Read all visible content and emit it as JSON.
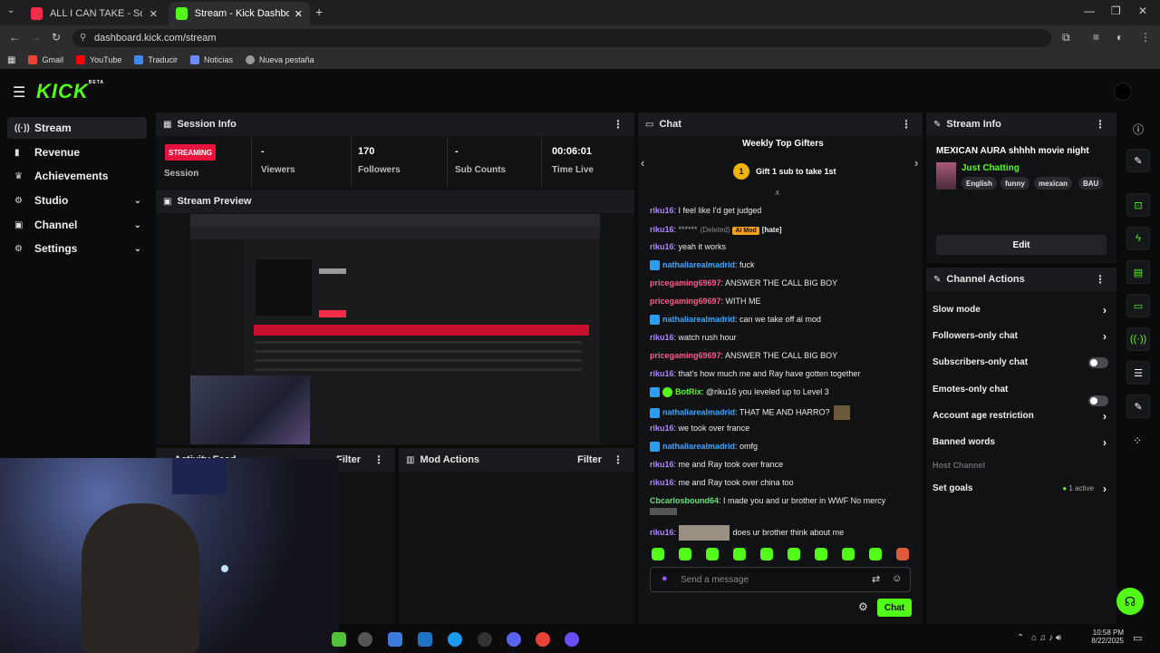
{
  "browser": {
    "tabs": [
      {
        "title": "ALL I CAN TAKE - Song by Justi"
      },
      {
        "title": "Stream - Kick Dashboard"
      }
    ],
    "url": "dashboard.kick.com/stream",
    "bookmarks": [
      "Gmail",
      "YouTube",
      "Traducir",
      "Noticias",
      "Nueva pestaña"
    ]
  },
  "app": {
    "logo": "KICK",
    "logo_badge": "BETA"
  },
  "sidebar": {
    "items": [
      {
        "label": "Stream",
        "icon": "broadcast-icon"
      },
      {
        "label": "Revenue",
        "icon": "revenue-icon"
      },
      {
        "label": "Achievements",
        "icon": "achievements-icon"
      },
      {
        "label": "Studio",
        "icon": "studio-icon"
      },
      {
        "label": "Channel",
        "icon": "channel-icon"
      },
      {
        "label": "Settings",
        "icon": "settings-icon"
      }
    ]
  },
  "session": {
    "title": "Session Info",
    "badge": "STREAMING",
    "session_label": "Session",
    "viewers_val": "-",
    "viewers_label": "Viewers",
    "followers_val": "170",
    "followers_label": "Followers",
    "subs_val": "-",
    "subs_label": "Sub Counts",
    "time_val": "00:06:01",
    "time_label": "Time Live"
  },
  "preview": {
    "title": "Stream Preview"
  },
  "activity": {
    "title": "Activity Feed",
    "filter": "Filter"
  },
  "mod": {
    "title": "Mod Actions",
    "filter": "Filter"
  },
  "chat": {
    "title": "Chat",
    "gifters_title": "Weekly Top Gifters",
    "gifters_rank": "1",
    "gifters_text": "Gift 1 sub to take 1st",
    "deleted": "(Deleted)",
    "ai_mod": "AI Mod",
    "hate": "[hate]",
    "masked": "******",
    "messages": [
      {
        "user": "riku16",
        "text": ": I feel like I'd get judged"
      },
      {
        "user": "riku16",
        "text": ": yeah it works"
      },
      {
        "user": "nathaliarealmadrid",
        "text": ": fuck"
      },
      {
        "user": "pricegaming69697",
        "text": ": ANSWER THE CALL BIG BOY"
      },
      {
        "user": "pricegaming69697",
        "text": ": WITH ME"
      },
      {
        "user": "nathaliarealmadrid",
        "text": ": can we take off ai mod"
      },
      {
        "user": "riku16",
        "text": ": watch rush hour"
      },
      {
        "user": "pricegaming69697",
        "text": ": ANSWER THE CALL BIG BOY"
      },
      {
        "user": "riku16",
        "text": ": that's how much me and Ray have gotten together"
      },
      {
        "user": "BotRix",
        "text": ": @riku16 you leveled up to Level 3"
      },
      {
        "user": "nathaliarealmadrid",
        "text": ": THAT ME AND HARRO?"
      },
      {
        "user": "riku16",
        "text": ": we took over france"
      },
      {
        "user": "nathaliarealmadrid",
        "text": ": omfg"
      },
      {
        "user": "riku16",
        "text": ": me and Ray took over france"
      },
      {
        "user": "riku16",
        "text": ": me and Ray took over china too"
      },
      {
        "user": "Cbcarlosbound64",
        "text": ": I made you and ur brother in WWF No mercy"
      },
      {
        "user": "riku16",
        "text": "does ur brother think about me"
      }
    ],
    "placeholder": "Send a message",
    "send_label": "Chat"
  },
  "stream_info": {
    "title": "Stream Info",
    "stream_title": "MEXICAN AURA shhhh movie night",
    "category": "Just Chatting",
    "tags": [
      "English",
      "funny",
      "mexican",
      "BAU"
    ],
    "edit_label": "Edit"
  },
  "channel_actions": {
    "title": "Channel Actions",
    "rows": [
      {
        "label": "Slow mode"
      },
      {
        "label": "Followers-only chat"
      },
      {
        "label": "Subscribers-only chat"
      },
      {
        "label": "Emotes-only chat"
      },
      {
        "label": "Account age restriction"
      },
      {
        "label": "Banned words"
      },
      {
        "label": "Host Channel"
      },
      {
        "label": "Set goals"
      }
    ],
    "goals_status": "1 active"
  },
  "taskbar": {
    "time": "10:58 PM",
    "date": "8/22/2025"
  },
  "colors": {
    "accent": "#53fc18",
    "streaming": "#e8123c",
    "background": "#0b0b0c",
    "panel": "#111214"
  }
}
